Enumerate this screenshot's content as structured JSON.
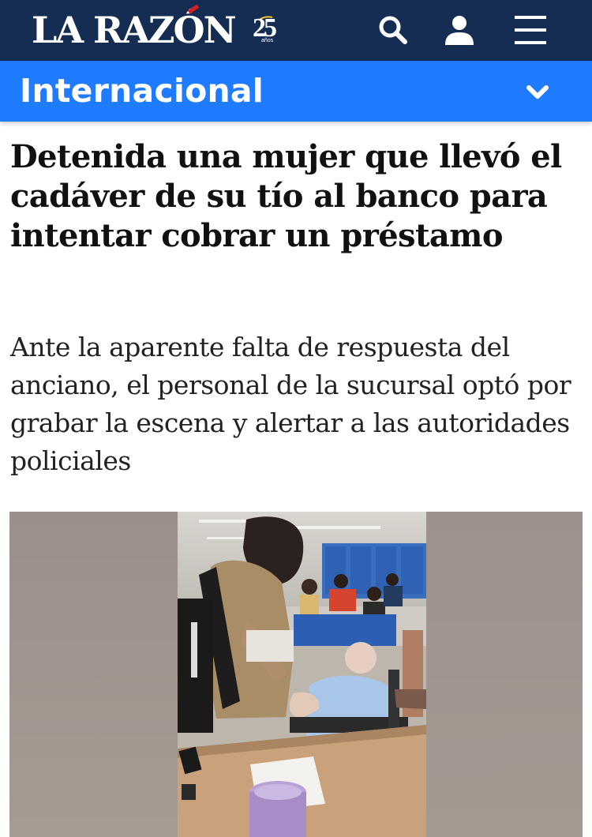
{
  "header": {
    "logo_text": "LA RAZÓN",
    "anniversary_number": "25",
    "anniversary_label": "años",
    "brand_navy": "#152d52",
    "brand_red": "#d71f26",
    "icons": [
      "search-icon",
      "user-icon",
      "menu-icon"
    ]
  },
  "section": {
    "label": "Internacional",
    "color": "#1f7bff",
    "icon": "chevron-down-icon"
  },
  "article": {
    "headline": "Detenida una mujer que llevó el cadáver de su tío al banco para intentar cobrar un préstamo",
    "subheadline": "Ante la aparente falta de respuesta del anciano, el personal de la sucursal optó por grabar la escena y alertar a las autoridades policiales"
  }
}
